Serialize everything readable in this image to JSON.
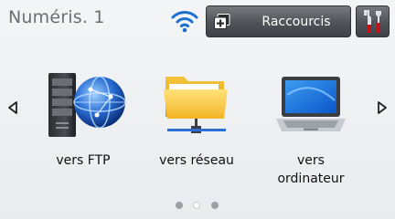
{
  "header": {
    "title": "Numéris. 1",
    "wifi_icon": "wifi-icon",
    "shortcut_button_label": "Raccourcis",
    "shortcut_icon": "plus-icon",
    "tools_icon": "tools-icon"
  },
  "nav": {
    "left_arrow": "chevron-left-icon",
    "right_arrow": "chevron-right-icon"
  },
  "tiles": [
    {
      "label": "vers FTP",
      "icon": "ftp-server-icon"
    },
    {
      "label": "vers réseau",
      "icon": "network-folder-icon"
    },
    {
      "label": "vers\nordinateur",
      "icon": "laptop-icon"
    }
  ],
  "pager": {
    "pages": 3,
    "current": 2
  },
  "colors": {
    "accent_blue": "#1b6fd1",
    "button_dark": "#4f5357"
  }
}
